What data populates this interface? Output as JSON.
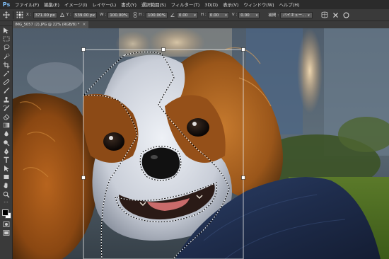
{
  "app": {
    "logo": "Ps"
  },
  "menu": {
    "items": [
      "ファイル(F)",
      "編集(E)",
      "イメージ(I)",
      "レイヤー(L)",
      "書式(Y)",
      "選択範囲(S)",
      "フィルター(T)",
      "3D(D)",
      "表示(V)",
      "ウィンドウ(W)",
      "ヘルプ(H)"
    ]
  },
  "options": {
    "x_label": "X :",
    "x_value": "371.00 px",
    "y_label": "Y :",
    "y_value": "539.00 px",
    "w_label": "W :",
    "w_value": "100.00%",
    "h_label": "H :",
    "h_value": "100.00%",
    "angle_value": "0.00",
    "hskew_label": "H :",
    "hskew_value": "0.00",
    "vskew_label": "V :",
    "vskew_value": "0.00",
    "interp_label": "補間 :",
    "interp_value": "バイキュー..."
  },
  "document": {
    "tab_title": "IMG_5057 (2).JPG @ 22% (RGB/8) *",
    "close_glyph": "×"
  },
  "toolbox": {
    "tools": [
      "move",
      "marquee",
      "lasso",
      "quick-select",
      "crop",
      "eyedropper",
      "healing",
      "brush",
      "clone-stamp",
      "history-brush",
      "eraser",
      "gradient",
      "blur",
      "dodge",
      "pen",
      "type",
      "path-select",
      "shape",
      "hand",
      "zoom"
    ]
  },
  "colors": {
    "menubar": "#2b2b2b",
    "panel": "#3a3a3a",
    "workspace": "#535353",
    "accent": "#7fbdf5"
  }
}
